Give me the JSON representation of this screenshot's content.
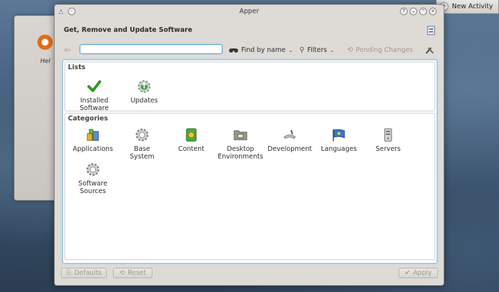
{
  "desktop": {
    "new_activity": "New Activity",
    "bg_help_label": "Hel"
  },
  "window": {
    "title": "Apper",
    "header_title": "Get, Remove and Update Software"
  },
  "toolbar": {
    "search_value": "",
    "find_by_name": "Find by name",
    "filters": "Filters",
    "pending_changes": "Pending Changes"
  },
  "lists": {
    "title": "Lists",
    "items": [
      {
        "label": "Installed\nSoftware",
        "icon": "checkmark-icon"
      },
      {
        "label": "Updates",
        "icon": "updates-icon"
      }
    ]
  },
  "categories": {
    "title": "Categories",
    "items": [
      {
        "label": "Applications",
        "icon": "applications-icon"
      },
      {
        "label": "Base\nSystem",
        "icon": "gear-icon"
      },
      {
        "label": "Content",
        "icon": "content-icon"
      },
      {
        "label": "Desktop\nEnvironments",
        "icon": "desktop-folder-icon"
      },
      {
        "label": "Development",
        "icon": "development-icon"
      },
      {
        "label": "Languages",
        "icon": "languages-flag-icon"
      },
      {
        "label": "Servers",
        "icon": "server-icon"
      },
      {
        "label": "Software\nSources",
        "icon": "gear-icon"
      }
    ]
  },
  "footer": {
    "defaults": "Defaults",
    "reset": "Reset",
    "apply": "Apply"
  },
  "colors": {
    "accent": "#5aa8d8",
    "check_green": "#2e9a1e"
  }
}
